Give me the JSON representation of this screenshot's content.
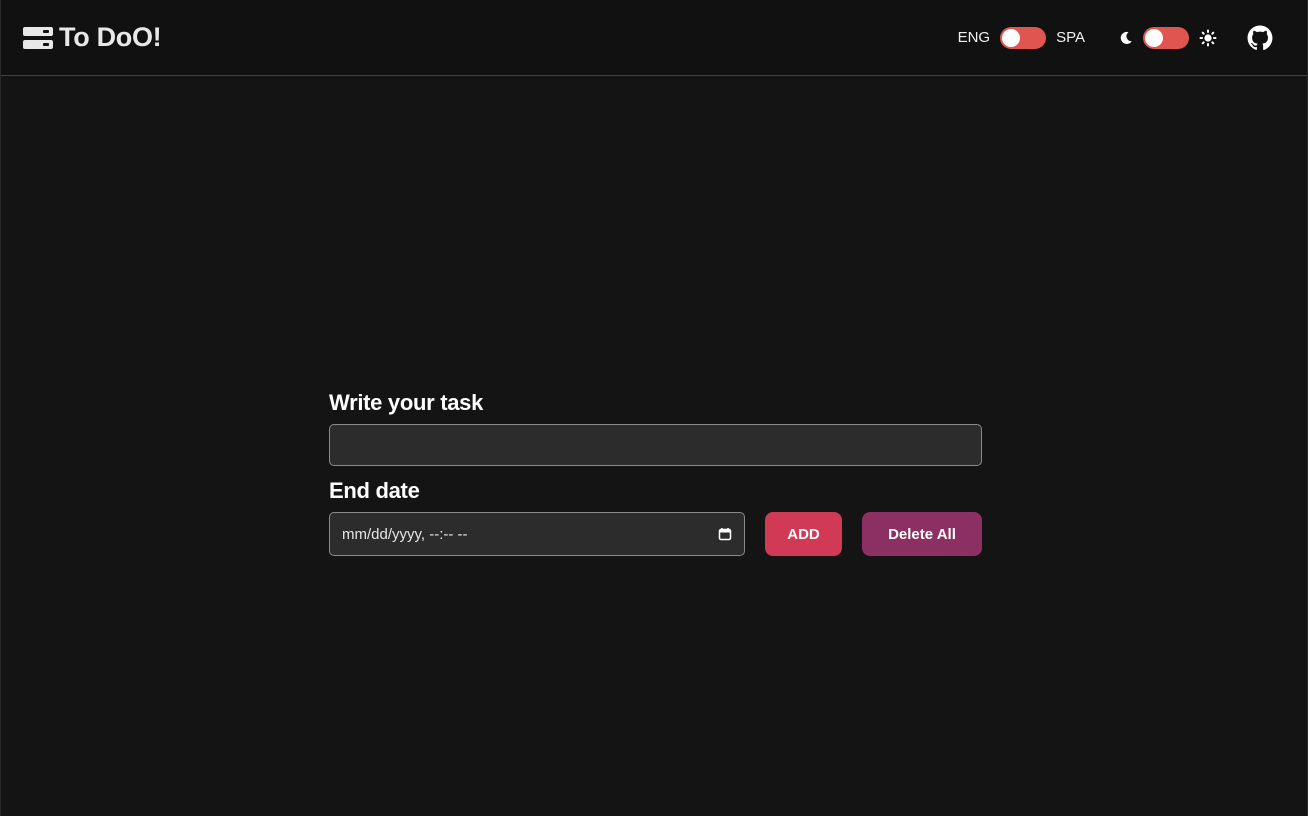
{
  "app": {
    "title": "To DoO!"
  },
  "navbar": {
    "language": {
      "left_label": "ENG",
      "right_label": "SPA",
      "toggle_color": "#e0554f"
    },
    "theme": {
      "left_icon": "moon-icon",
      "right_icon": "sun-icon"
    },
    "github_icon": "github-icon"
  },
  "form": {
    "task_label": "Write your task",
    "task_value": "",
    "date_label": "End date",
    "date_placeholder": "mm/dd/yyyy, --:-- --",
    "add_label": "ADD",
    "delete_all_label": "Delete All"
  },
  "colors": {
    "background": "#141414",
    "navbar_border": "#7a2a2a",
    "add_button": "#d03a55",
    "delete_button": "#8c2f62"
  }
}
